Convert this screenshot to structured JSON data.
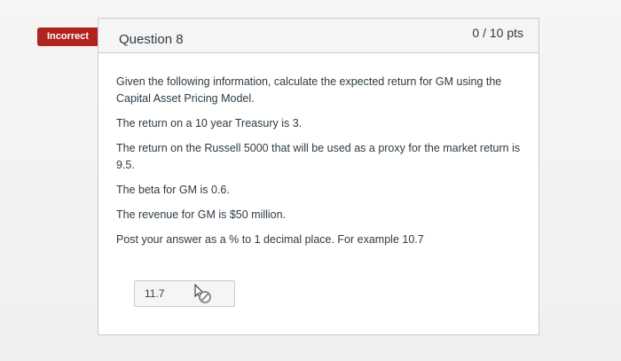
{
  "badge": {
    "label": "Incorrect",
    "color": "#b1231e"
  },
  "question": {
    "title": "Question 8",
    "points": "0 / 10 pts",
    "paragraphs": [
      "Given the following information, calculate the expected return for GM using the Capital Asset Pricing Model.",
      "The return on a 10 year Treasury is 3.",
      "The return on the Russell 5000 that will be used as a proxy for the market return is 9.5.",
      "The beta for GM is 0.6.",
      "The revenue for GM is $50 million.",
      "Post your answer as a % to 1 decimal place. For example 10.7"
    ],
    "answer": {
      "value": "11.7",
      "cursor_icon": "not-allowed-cursor-icon"
    }
  }
}
